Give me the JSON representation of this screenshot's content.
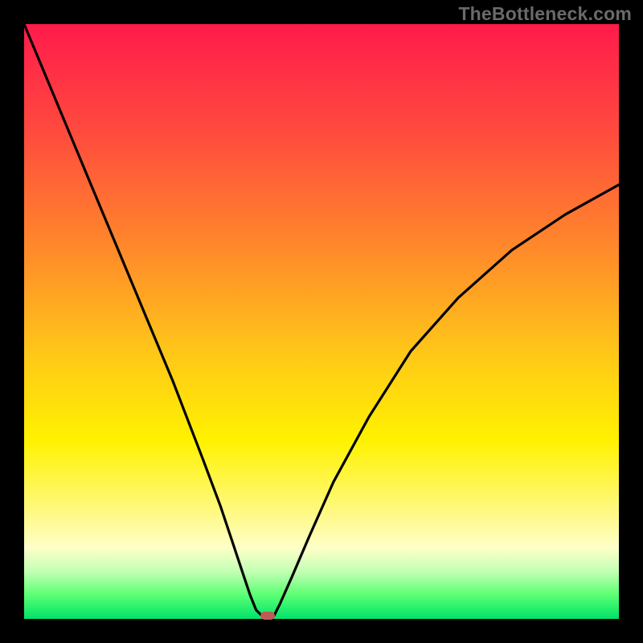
{
  "watermark": "TheBottleneck.com",
  "colors": {
    "background": "#000000",
    "gradient_top": "#ff1b4b",
    "gradient_bottom": "#00e36a",
    "curve_stroke": "#000000",
    "marker_fill": "#c15a57"
  },
  "chart_data": {
    "type": "line",
    "title": "",
    "xlabel": "",
    "ylabel": "",
    "xlim": [
      0,
      100
    ],
    "ylim": [
      0,
      100
    ],
    "annotations": [
      {
        "name": "optimal-point-marker",
        "x": 41,
        "y": 0
      }
    ],
    "series": [
      {
        "name": "bottleneck-curve",
        "x": [
          0,
          5,
          10,
          15,
          20,
          25,
          30,
          33,
          35,
          37,
          38,
          39,
          40,
          41,
          42,
          43,
          45,
          48,
          52,
          58,
          65,
          73,
          82,
          91,
          100
        ],
        "values": [
          100,
          88,
          76,
          64,
          52,
          40,
          27,
          19,
          13,
          7,
          4,
          1.5,
          0.5,
          0,
          0.5,
          2.5,
          7,
          14,
          23,
          34,
          45,
          54,
          62,
          68,
          73
        ]
      }
    ]
  }
}
